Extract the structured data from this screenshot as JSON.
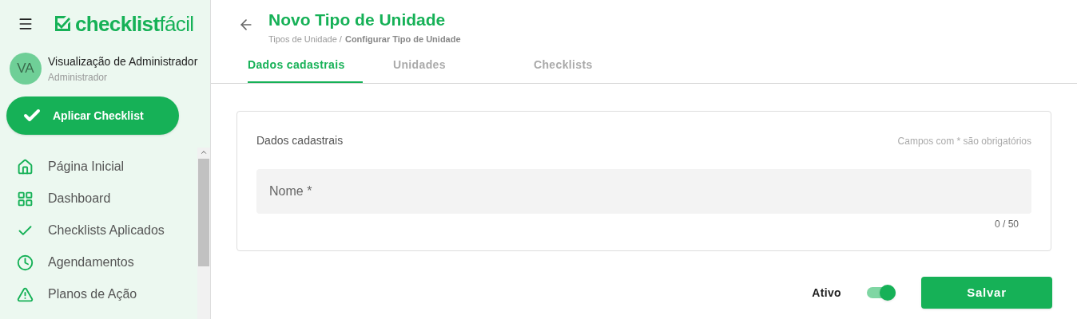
{
  "sidebar": {
    "logo": "**checklist**fácil",
    "user": {
      "initials": "VA",
      "name": "Visualização de Administrador",
      "role": "Administrador"
    },
    "apply_button": "Aplicar Checklist",
    "items": [
      {
        "kind": "home",
        "label": "Página Inicial"
      },
      {
        "kind": "dashboard",
        "label": "Dashboard"
      },
      {
        "kind": "check",
        "label": "Checklists Aplicados"
      },
      {
        "kind": "clock",
        "label": "Agendamentos"
      },
      {
        "kind": "warning",
        "label": "Planos de Ação"
      }
    ]
  },
  "header": {
    "title": "Novo Tipo de Unidade",
    "breadcrumb": [
      "Tipos de Unidade /",
      "Configurar Tipo de Unidade"
    ]
  },
  "tabs": [
    {
      "label": "Dados cadastrais",
      "selected": true
    },
    {
      "label": "Unidades",
      "selected": false
    },
    {
      "label": "Checklists",
      "selected": false
    }
  ],
  "card": {
    "title": "Dados cadastrais",
    "hint": "Campos com * são obrigatórios",
    "field": {
      "placeholder": "Nome *",
      "counter": "0 / 50"
    }
  },
  "footer": {
    "active_label": "Ativo",
    "active": {
      "on": true
    },
    "save_button": "Salvar"
  }
}
